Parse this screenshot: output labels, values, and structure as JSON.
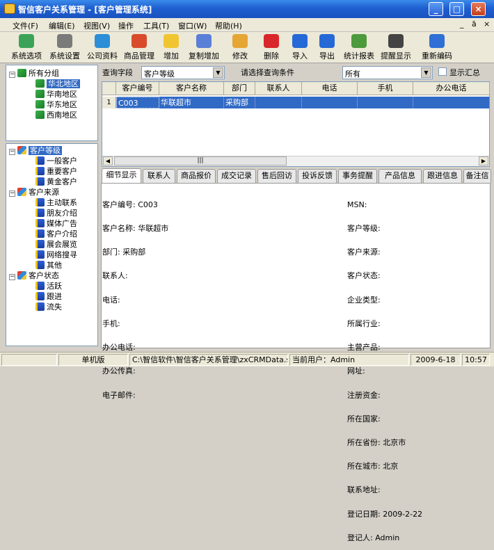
{
  "window": {
    "title": "智信客户关系管理 - [客户管理系统]",
    "min": "_",
    "max": "□",
    "close": "×"
  },
  "menu": [
    "文件(F)",
    "编辑(E)",
    "视图(V)",
    "操作",
    "工具(T)",
    "窗口(W)",
    "帮助(H)"
  ],
  "mdi_controls": [
    "_",
    "ā",
    "×"
  ],
  "toolbar": [
    {
      "label": "系统选项",
      "color": "#3aa357"
    },
    {
      "label": "系统设置",
      "color": "#7a7a7a"
    },
    {
      "label": "公司资料",
      "color": "#2b8ed6"
    },
    {
      "label": "商品管理",
      "color": "#d94b2b"
    },
    {
      "label": "增加",
      "color": "#f1c531"
    },
    {
      "label": "复制增加",
      "color": "#5a7fd6"
    },
    {
      "label": "修改",
      "color": "#e6a634"
    },
    {
      "label": "删除",
      "color": "#d9262b"
    },
    {
      "label": "导入",
      "color": "#2569d6"
    },
    {
      "label": "导出",
      "color": "#2569d6"
    },
    {
      "label": "统计报表",
      "color": "#4b9a3c"
    },
    {
      "label": "提醒显示",
      "color": "#444444"
    },
    {
      "label": "重新编码",
      "color": "#2f6fd6"
    }
  ],
  "tree_groups": {
    "root": "所有分组",
    "items": [
      "华北地区",
      "华南地区",
      "华东地区",
      "西南地区"
    ]
  },
  "tree_level": {
    "root": "客户等级",
    "items": [
      "一般客户",
      "重要客户",
      "黄金客户"
    ],
    "source_root": "客户来源",
    "source_items": [
      "主动联系",
      "朋友介绍",
      "媒体广告",
      "客户介绍",
      "展会展览",
      "网络搜寻",
      "其他"
    ],
    "status_root": "客户状态",
    "status_items": [
      "活跃",
      "跟进",
      "流失"
    ]
  },
  "query": {
    "field_label": "查询字段",
    "field_value": "客户等级",
    "cond_label": "请选择查询条件",
    "cond_value": "所有",
    "show_summary": "显示汇总"
  },
  "grid": {
    "columns": [
      "客户编号",
      "客户名称",
      "部门",
      "联系人",
      "电话",
      "手机",
      "办公电话"
    ],
    "rows": [
      {
        "num": "1",
        "cells": [
          "C003",
          "华联超市",
          "采购部",
          "",
          "",
          "",
          ""
        ]
      }
    ],
    "hscroll_grip": "|||"
  },
  "tabs": [
    "细节显示",
    "联系人",
    "商品报价",
    "成交记录",
    "售后回访",
    "投诉反馈",
    "事务提醒",
    "产品信息",
    "跟进信息",
    "备注信"
  ],
  "detail_left": [
    "客户编号: C003",
    "客户名称: 华联超市",
    "部门: 采购部",
    "联系人:",
    "电话:",
    "手机:",
    "办公电话:",
    "办公传真:",
    "电子邮件:"
  ],
  "detail_right": [
    "MSN:",
    "客户等级:",
    "客户来源:",
    "客户状态:",
    "企业类型:",
    "所属行业:",
    "主营产品:",
    "网址:",
    "注册资金:",
    "所在国家:",
    "所在省份: 北京市",
    "所在城市: 北京",
    "联系地址:",
    "登记日期: 2009-2-22",
    "登记人: Admin"
  ],
  "status": {
    "edition": "单机版",
    "path": "C:\\智信软件\\智信客户关系管理\\zxCRMData.sys",
    "user": "当前用户：Admin",
    "date": "2009-6-18",
    "time": "10:57"
  }
}
